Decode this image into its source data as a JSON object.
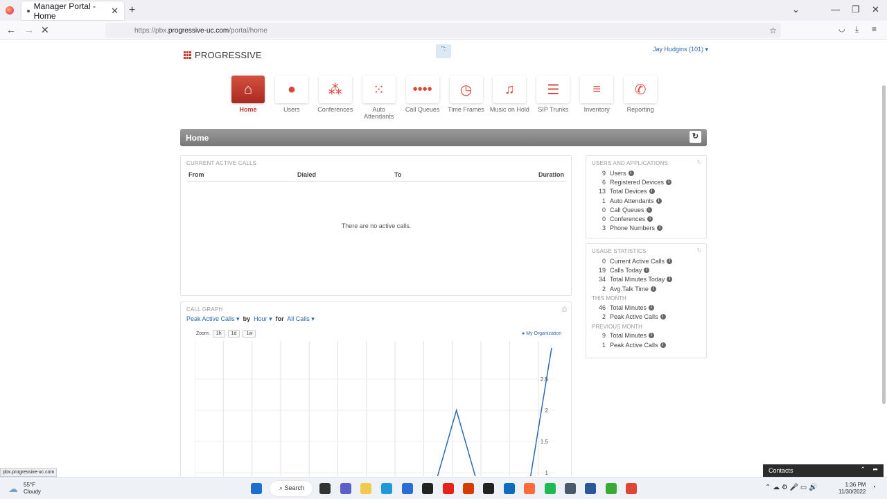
{
  "browser": {
    "tab_title": "Manager Portal - Home",
    "url_prefix": "https://pbx.",
    "url_host": "progressive-uc.com",
    "url_path": "/portal/home",
    "status_url": "pbx.progressive-uc.com"
  },
  "header": {
    "logo_text": "PROGRESSIVE",
    "spinner": "'':",
    "user_menu": "Jay Hudgins (101) ▾"
  },
  "nav": [
    {
      "label": "Home",
      "icon": "home-icon"
    },
    {
      "label": "Users",
      "icon": "user-icon"
    },
    {
      "label": "Conferences",
      "icon": "conference-icon"
    },
    {
      "label": "Auto Attendants",
      "icon": "keypad-icon"
    },
    {
      "label": "Call Queues",
      "icon": "queue-icon"
    },
    {
      "label": "Time Frames",
      "icon": "clock-icon"
    },
    {
      "label": "Music on Hold",
      "icon": "music-icon"
    },
    {
      "label": "SIP Trunks",
      "icon": "server-icon"
    },
    {
      "label": "Inventory",
      "icon": "list-icon"
    },
    {
      "label": "Reporting",
      "icon": "phone-chart-icon"
    }
  ],
  "page_title": "Home",
  "active_calls": {
    "title": "CURRENT ACTIVE CALLS",
    "columns": [
      "From",
      "Dialed",
      "To",
      "Duration"
    ],
    "empty_text": "There are no active calls."
  },
  "users_apps": {
    "title": "USERS AND APPLICATIONS",
    "items": [
      {
        "n": "9",
        "label": "Users"
      },
      {
        "n": "6",
        "label": "Registered Devices"
      },
      {
        "n": "13",
        "label": "Total Devices"
      },
      {
        "n": "1",
        "label": "Auto Attendants"
      },
      {
        "n": "0",
        "label": "Call Queues"
      },
      {
        "n": "0",
        "label": "Conferences"
      },
      {
        "n": "3",
        "label": "Phone Numbers"
      }
    ]
  },
  "usage": {
    "title": "USAGE STATISTICS",
    "items": [
      {
        "n": "0",
        "label": "Current Active Calls"
      },
      {
        "n": "19",
        "label": "Calls Today"
      },
      {
        "n": "34",
        "label": "Total Minutes Today"
      },
      {
        "n": "2",
        "label": "Avg.Talk Time"
      }
    ],
    "this_month_label": "THIS MONTH",
    "this_month": [
      {
        "n": "46",
        "label": "Total Minutes"
      },
      {
        "n": "2",
        "label": "Peak Active Calls"
      }
    ],
    "prev_month_label": "PREVIOUS MONTH",
    "prev_month": [
      {
        "n": "9",
        "label": "Total Minutes"
      },
      {
        "n": "1",
        "label": "Peak Active Calls"
      }
    ]
  },
  "graph": {
    "title": "CALL GRAPH",
    "metric": "Peak Active Calls",
    "by_word": "by",
    "interval": "Hour",
    "for_word": "for",
    "filter": "All Calls",
    "zoom_label": "Zoom:",
    "zoom_options": [
      "1h",
      "1d",
      "1w"
    ],
    "legend": "My Organization"
  },
  "chart_data": {
    "type": "line",
    "series": [
      {
        "name": "My Organization",
        "values": [
          0,
          0,
          0,
          0,
          0,
          0,
          0,
          0,
          0,
          0,
          0,
          2,
          0,
          0,
          0,
          3
        ]
      }
    ],
    "ylim": [
      1,
      3
    ],
    "yticks": [
      "2.5",
      "2",
      "1.5",
      "1"
    ]
  },
  "contacts_label": "Contacts",
  "taskbar": {
    "temp": "55°F",
    "weather": "Cloudy",
    "search": "Search",
    "time": "1:36 PM",
    "date": "11/30/2022"
  },
  "colors": {
    "accent": "#d9473a",
    "link": "#2a6ab0"
  }
}
